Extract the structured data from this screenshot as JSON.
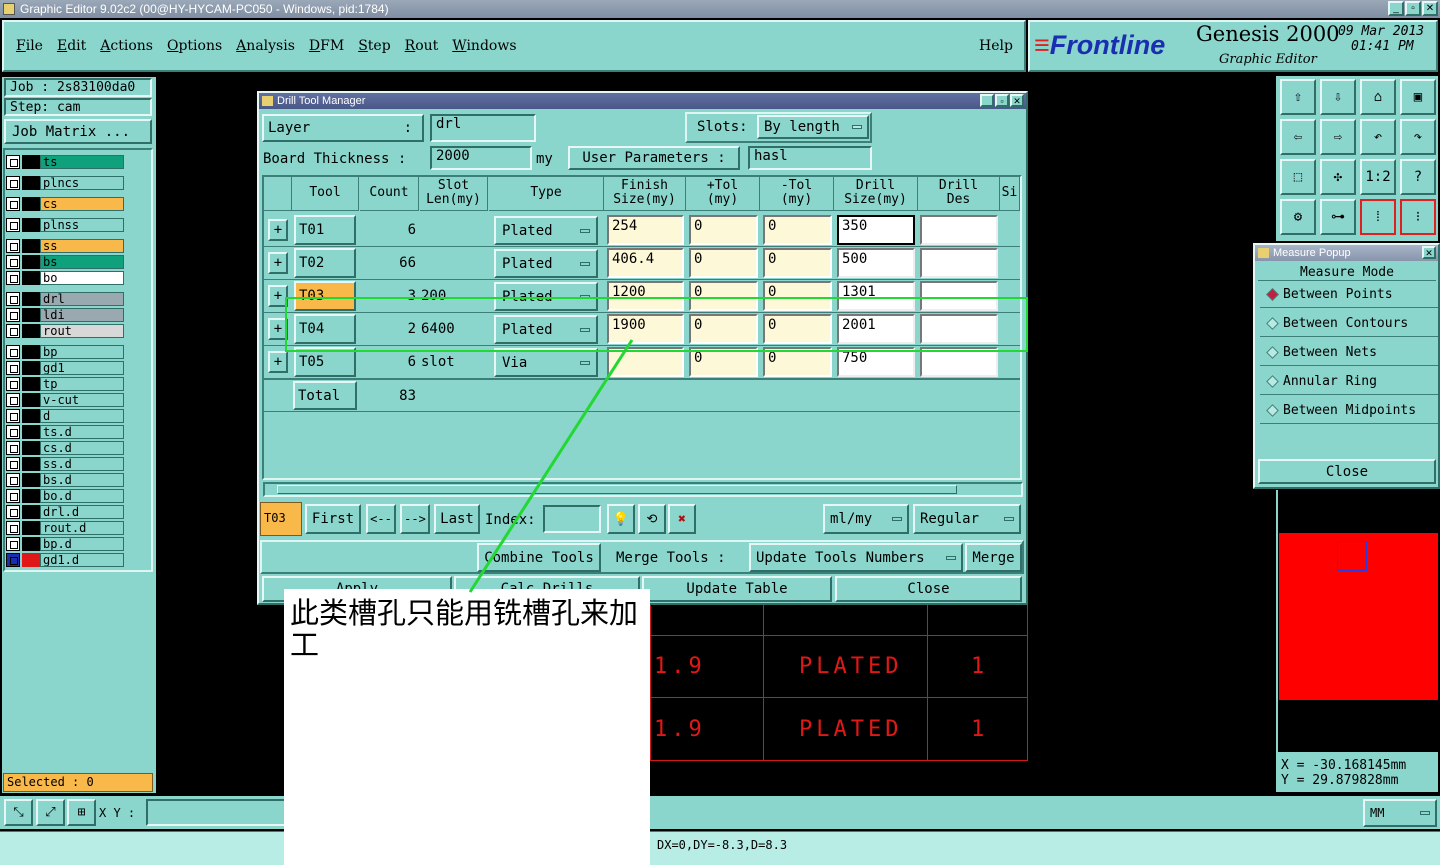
{
  "window_title": "Graphic Editor 9.02c2 (00@HY-HYCAM-PC050 - Windows, pid:1784)",
  "menu": [
    "File",
    "Edit",
    "Actions",
    "Options",
    "Analysis",
    "DFM",
    "Step",
    "Rout",
    "Windows"
  ],
  "help": "Help",
  "brand": {
    "logo": "Frontline",
    "product": "Genesis 2000",
    "subtitle": "Graphic Editor",
    "date": "09 Mar 2013",
    "time": "01:41 PM"
  },
  "job": "Job : 2s83100da0",
  "step": "Step: cam",
  "job_matrix": "Job Matrix ...",
  "layers": [
    "ts",
    "plncs",
    "cs",
    "plnss",
    "ss",
    "bs",
    "bo",
    "drl",
    "ldi",
    "rout",
    "bp",
    "gd1",
    "tp",
    "v-cut",
    "d",
    "ts.d",
    "cs.d",
    "ss.d",
    "bs.d",
    "bo.d",
    "drl.d",
    "rout.d",
    "bp.d",
    "gd1.d"
  ],
  "selected": "Selected : 0",
  "xy_label": "X Y :",
  "units": "MM",
  "status": "DX=0,DY=-8.3,D=8.3",
  "dtm": {
    "title": "Drill Tool Manager",
    "layer_label": "Layer",
    "layer_sep": ":",
    "layer_value": "drl",
    "slots_label": "Slots:",
    "slots_value": "By length",
    "thickness_label": "Board Thickness :",
    "thickness_value": "2000",
    "thickness_unit": "my",
    "user_params": "User Parameters :",
    "user_params_value": "hasl",
    "headers": [
      "Tool",
      "Count",
      "Slot\nLen(my)",
      "Type",
      "Finish\nSize(my)",
      "+Tol\n(my)",
      "-Tol\n(my)",
      "Drill\nSize(my)",
      "Drill\nDes",
      "Si"
    ],
    "rows": [
      {
        "tool": "T01",
        "count": "6",
        "slot": "",
        "type": "Plated",
        "finish": "254",
        "ptol": "0",
        "ntol": "0",
        "drill": "350",
        "des": ""
      },
      {
        "tool": "T02",
        "count": "66",
        "slot": "",
        "type": "Plated",
        "finish": "406.4",
        "ptol": "0",
        "ntol": "0",
        "drill": "500",
        "des": ""
      },
      {
        "tool": "T03",
        "count": "3",
        "slot": "200",
        "type": "Plated",
        "finish": "1200",
        "ptol": "0",
        "ntol": "0",
        "drill": "1301",
        "des": ""
      },
      {
        "tool": "T04",
        "count": "2",
        "slot": "6400",
        "type": "Plated",
        "finish": "1900",
        "ptol": "0",
        "ntol": "0",
        "drill": "2001",
        "des": ""
      },
      {
        "tool": "T05",
        "count": "6",
        "slot": "slot",
        "type": "Via",
        "finish": "",
        "ptol": "0",
        "ntol": "0",
        "drill": "750",
        "des": ""
      }
    ],
    "total_label": "Total",
    "total_count": "83",
    "current_tool": "T03",
    "first": "First",
    "prev": "<--",
    "next": "-->",
    "last": "Last",
    "index_label": "Index:",
    "unit_menu": "ml/my",
    "mode_menu": "Regular",
    "combine": "Combine Tools",
    "merge_tools": "Merge Tools :",
    "update_numbers": "Update Tools Numbers",
    "merge": "Merge",
    "apply": "Apply",
    "calc": "Calc Drills",
    "update_table": "Update Table",
    "close": "Close"
  },
  "measure": {
    "title": "Measure Popup",
    "mode": "Measure Mode",
    "items": [
      "Between Points",
      "Between Contours",
      "Between Nets",
      "Annular Ring",
      "Between Midpoints"
    ],
    "close": "Close"
  },
  "coords": {
    "x": "X = -30.168145mm",
    "y": "Y = 29.879828mm"
  },
  "annotation": "此类槽孔只能用铣槽孔来加工",
  "canvas_rows": [
    {
      "v": "1.9",
      "t": "PLATED",
      "n": "1"
    },
    {
      "v": "1.9",
      "t": "PLATED",
      "n": "1"
    }
  ],
  "toolbar_icons": [
    "save-up-icon",
    "save-down-icon",
    "home-icon",
    "window-icon",
    "left-icon",
    "right-icon",
    "undo-icon",
    "redo-icon",
    "fit-icon",
    "center-icon",
    "scale-icon",
    "help-icon",
    "tools-icon",
    "probe-icon",
    "netlist-icon",
    "netlist2-icon"
  ],
  "toolbar_glyphs": [
    "⇧",
    "⇩",
    "⌂",
    "▣",
    "⇦",
    "⇨",
    "↶",
    "↷",
    "⬚",
    "✣",
    "1:2",
    "?",
    "⚙",
    "⊶",
    "⁞",
    "⁝"
  ]
}
